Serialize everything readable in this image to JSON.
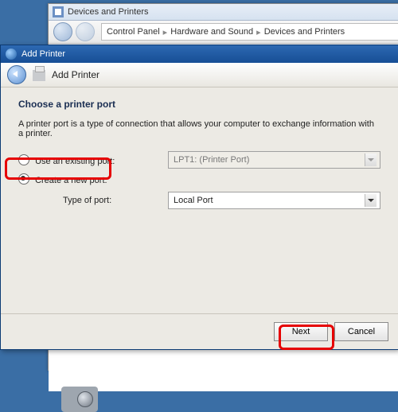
{
  "bg": {
    "title": "Devices and Printers",
    "breadcrumb": [
      "Control Panel",
      "Hardware and Sound",
      "Devices and Printers"
    ]
  },
  "dialog": {
    "title": "Add Printer",
    "subtitle": "Add Printer",
    "heading": "Choose a printer port",
    "description": "A printer port is a type of connection that allows your computer to exchange information with a printer.",
    "options": {
      "existing_label": "Use an existing port:",
      "existing_value": "LPT1: (Printer Port)",
      "create_label": "Create a new port:",
      "type_label": "Type of port:",
      "type_value": "Local Port",
      "selected": "create"
    },
    "buttons": {
      "next": "Next",
      "cancel": "Cancel"
    }
  }
}
